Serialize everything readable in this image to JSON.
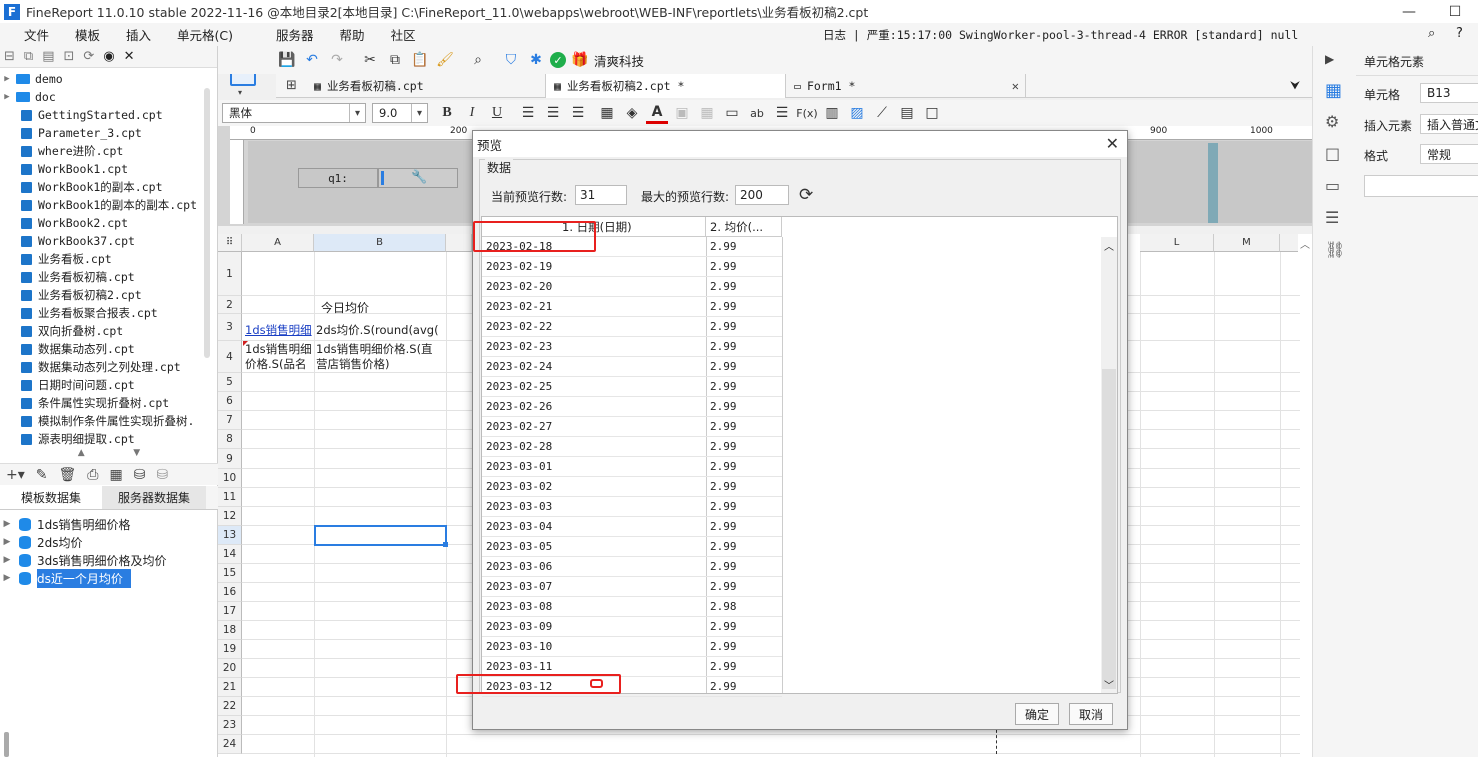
{
  "window": {
    "title": "FineReport 11.0.10 stable 2022-11-16 @本地目录2[本地目录]    C:\\FineReport_11.0\\webapps\\webroot\\WEB-INF\\reportlets\\业务看板初稿2.cpt",
    "minimize": "—",
    "maximize": "☐"
  },
  "menu": {
    "items": [
      "文件",
      "模板",
      "插入",
      "单元格(C)",
      "服务器",
      "帮助",
      "社区"
    ],
    "log_text": "日志 | 严重:15:17:00 SwingWorker-pool-3-thread-4 ERROR [standard] null"
  },
  "file_tree": {
    "items": [
      {
        "name": "demo",
        "type": "folder"
      },
      {
        "name": "doc",
        "type": "folder"
      },
      {
        "name": "GettingStarted.cpt",
        "type": "file"
      },
      {
        "name": "Parameter_3.cpt",
        "type": "file"
      },
      {
        "name": "where进阶.cpt",
        "type": "file"
      },
      {
        "name": "WorkBook1.cpt",
        "type": "file"
      },
      {
        "name": "WorkBook1的副本.cpt",
        "type": "file"
      },
      {
        "name": "WorkBook1的副本的副本.cpt",
        "type": "file"
      },
      {
        "name": "WorkBook2.cpt",
        "type": "file"
      },
      {
        "name": "WorkBook37.cpt",
        "type": "file"
      },
      {
        "name": "业务看板.cpt",
        "type": "file"
      },
      {
        "name": "业务看板初稿.cpt",
        "type": "file"
      },
      {
        "name": "业务看板初稿2.cpt",
        "type": "file"
      },
      {
        "name": "业务看板聚合报表.cpt",
        "type": "file"
      },
      {
        "name": "双向折叠树.cpt",
        "type": "file"
      },
      {
        "name": "数据集动态列.cpt",
        "type": "file"
      },
      {
        "name": "数据集动态列之列处理.cpt",
        "type": "file"
      },
      {
        "name": "日期时间问题.cpt",
        "type": "file"
      },
      {
        "name": "条件属性实现折叠树.cpt",
        "type": "file"
      },
      {
        "name": "模拟制作条件属性实现折叠树.",
        "type": "file"
      },
      {
        "name": "源表明细提取.cpt",
        "type": "file"
      }
    ]
  },
  "dataset_panel": {
    "tabs": [
      "模板数据集",
      "服务器数据集"
    ],
    "items": [
      "1ds销售明细价格",
      "2ds均价",
      "3ds销售明细价格及均价",
      "ds近一个月均价"
    ],
    "selected": "ds近一个月均价"
  },
  "editor_tabs": [
    {
      "label": "业务看板初稿.cpt",
      "active": false
    },
    {
      "label": "业务看板初稿2.cpt *",
      "active": true
    },
    {
      "label": "Form1 *",
      "active": false
    }
  ],
  "format_bar": {
    "font": "黑体",
    "size": "9.0",
    "bold": "B",
    "italic": "I",
    "underline": "U"
  },
  "ruler_marks": [
    "0",
    "200",
    "900",
    "1000"
  ],
  "param_pane": {
    "label": "q1:"
  },
  "sheet": {
    "columns": [
      "A",
      "B",
      "L",
      "M"
    ],
    "rows": [
      "1",
      "2",
      "3",
      "4",
      "5",
      "6",
      "7",
      "8",
      "9",
      "10",
      "11",
      "12",
      "13",
      "14",
      "15",
      "16",
      "17",
      "18",
      "19",
      "20",
      "21",
      "22",
      "23",
      "24"
    ],
    "cells": {
      "B2": "今日均价",
      "A3": "1ds销售明细",
      "B3": "2ds均价.S(round(avg(",
      "A4_line1": "1ds销售明细",
      "A4_line2": "价格.S(品名",
      "B4_line1": "1ds销售明细价格.S(直",
      "B4_line2": "营店销售价格)"
    },
    "selected_cell": "B13"
  },
  "right_panel": {
    "title": "单元格元素",
    "cell_label": "单元格",
    "cell_value": "B13",
    "insert_label": "插入元素",
    "insert_value": "插入普通文",
    "format_label": "格式",
    "format_value": "常规"
  },
  "preview_dialog": {
    "title": "预览",
    "group_label": "数据",
    "current_rows_label": "当前预览行数:",
    "current_rows_value": "31",
    "max_rows_label": "最大的预览行数:",
    "max_rows_value": "200",
    "columns": [
      "1. 日期(日期)",
      "2. 均价(..."
    ],
    "rows": [
      [
        "2023-02-18",
        "2.99"
      ],
      [
        "2023-02-19",
        "2.99"
      ],
      [
        "2023-02-20",
        "2.99"
      ],
      [
        "2023-02-21",
        "2.99"
      ],
      [
        "2023-02-22",
        "2.99"
      ],
      [
        "2023-02-23",
        "2.99"
      ],
      [
        "2023-02-24",
        "2.99"
      ],
      [
        "2023-02-25",
        "2.99"
      ],
      [
        "2023-02-26",
        "2.99"
      ],
      [
        "2023-02-27",
        "2.99"
      ],
      [
        "2023-02-28",
        "2.99"
      ],
      [
        "2023-03-01",
        "2.99"
      ],
      [
        "2023-03-02",
        "2.99"
      ],
      [
        "2023-03-03",
        "2.99"
      ],
      [
        "2023-03-04",
        "2.99"
      ],
      [
        "2023-03-05",
        "2.99"
      ],
      [
        "2023-03-06",
        "2.99"
      ],
      [
        "2023-03-07",
        "2.99"
      ],
      [
        "2023-03-08",
        "2.98"
      ],
      [
        "2023-03-09",
        "2.99"
      ],
      [
        "2023-03-10",
        "2.99"
      ],
      [
        "2023-03-11",
        "2.99"
      ],
      [
        "2023-03-12",
        "2.99"
      ]
    ],
    "ok_label": "确定",
    "cancel_label": "取消"
  },
  "colors": {
    "accent": "#2a7de1",
    "highlight": "#e8201e",
    "selection_border": "#2a7de1"
  }
}
